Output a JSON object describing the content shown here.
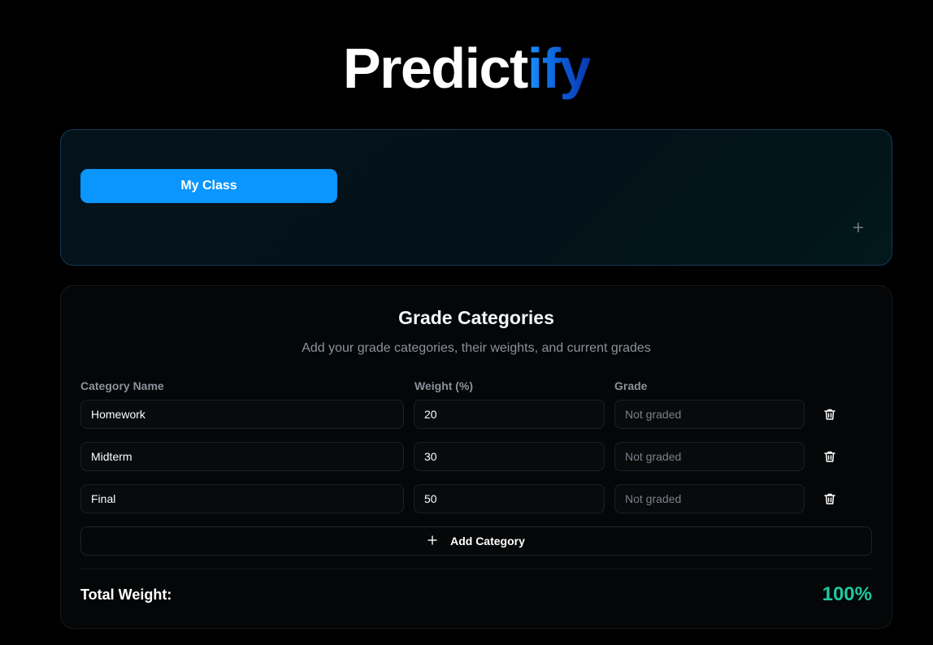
{
  "app": {
    "logo_plain": "Predict",
    "logo_accent": "ify"
  },
  "classes": {
    "active_class_label": "My Class"
  },
  "grade_categories": {
    "title": "Grade Categories",
    "subtitle": "Add your grade categories, their weights, and current grades",
    "headers": {
      "name": "Category Name",
      "weight": "Weight (%)",
      "grade": "Grade"
    },
    "rows": [
      {
        "name": "Homework",
        "weight": "20",
        "grade": "",
        "grade_placeholder": "Not graded"
      },
      {
        "name": "Midterm",
        "weight": "30",
        "grade": "",
        "grade_placeholder": "Not graded"
      },
      {
        "name": "Final",
        "weight": "50",
        "grade": "",
        "grade_placeholder": "Not graded"
      }
    ],
    "add_label": "Add Category",
    "total_label": "Total Weight:",
    "total_value": "100%"
  },
  "colors": {
    "accent_blue": "#0a95ff",
    "total_green": "#1fc7a0"
  },
  "icons": {
    "add_class": "plus-icon",
    "delete_row": "trash-icon",
    "add_category": "plus-icon"
  }
}
